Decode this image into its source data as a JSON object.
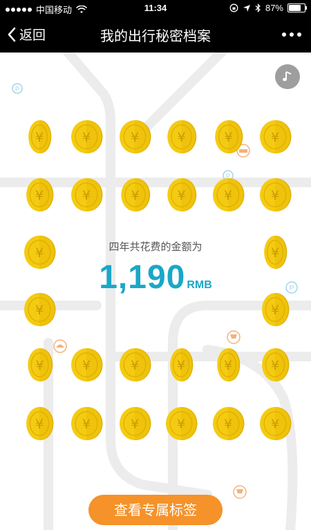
{
  "status_bar": {
    "carrier": "中国移动",
    "time": "11:34",
    "battery": "87%",
    "battery_level": 0.87
  },
  "nav": {
    "back_label": "返回",
    "title": "我的出行秘密档案"
  },
  "summary": {
    "label": "四年共花费的金额为",
    "amount": "1,190",
    "unit": "RMB"
  },
  "cta": {
    "label": "查看专属标签"
  },
  "colors": {
    "accent_blue": "#1aa7c8",
    "coin_gold": "#f4cb12",
    "button_orange": "#f5922a"
  },
  "icons": {
    "music": "music-note-icon",
    "parking": "parking-icon",
    "taxi": "car-icon",
    "restaurant": "food-icon",
    "shopping": "cart-icon"
  }
}
